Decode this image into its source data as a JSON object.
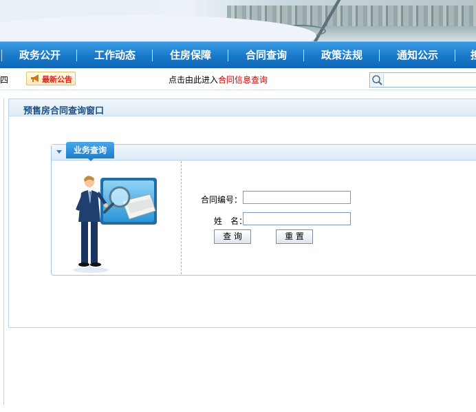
{
  "nav": {
    "items": [
      "政务公开",
      "工作动态",
      "住房保障",
      "合同查询",
      "政策法规",
      "通知公示",
      "担"
    ]
  },
  "notice": {
    "cut_text": "四",
    "badge_label": "最新公告",
    "enter_prefix": "点击由此进入",
    "enter_link": "合同信息查询"
  },
  "search": {
    "placeholder": "",
    "value": ""
  },
  "panel": {
    "title": "预售房合同查询窗口"
  },
  "box": {
    "tab_label": "业务查询"
  },
  "form": {
    "contract_label": "合同编号：",
    "contract_value": "",
    "name_label": "姓　名：",
    "name_value": "",
    "query_button": "查 询",
    "reset_button": "重 置"
  },
  "colors": {
    "nav": "#1979c9",
    "accent_red": "#d10000",
    "title": "#1b4f86"
  }
}
